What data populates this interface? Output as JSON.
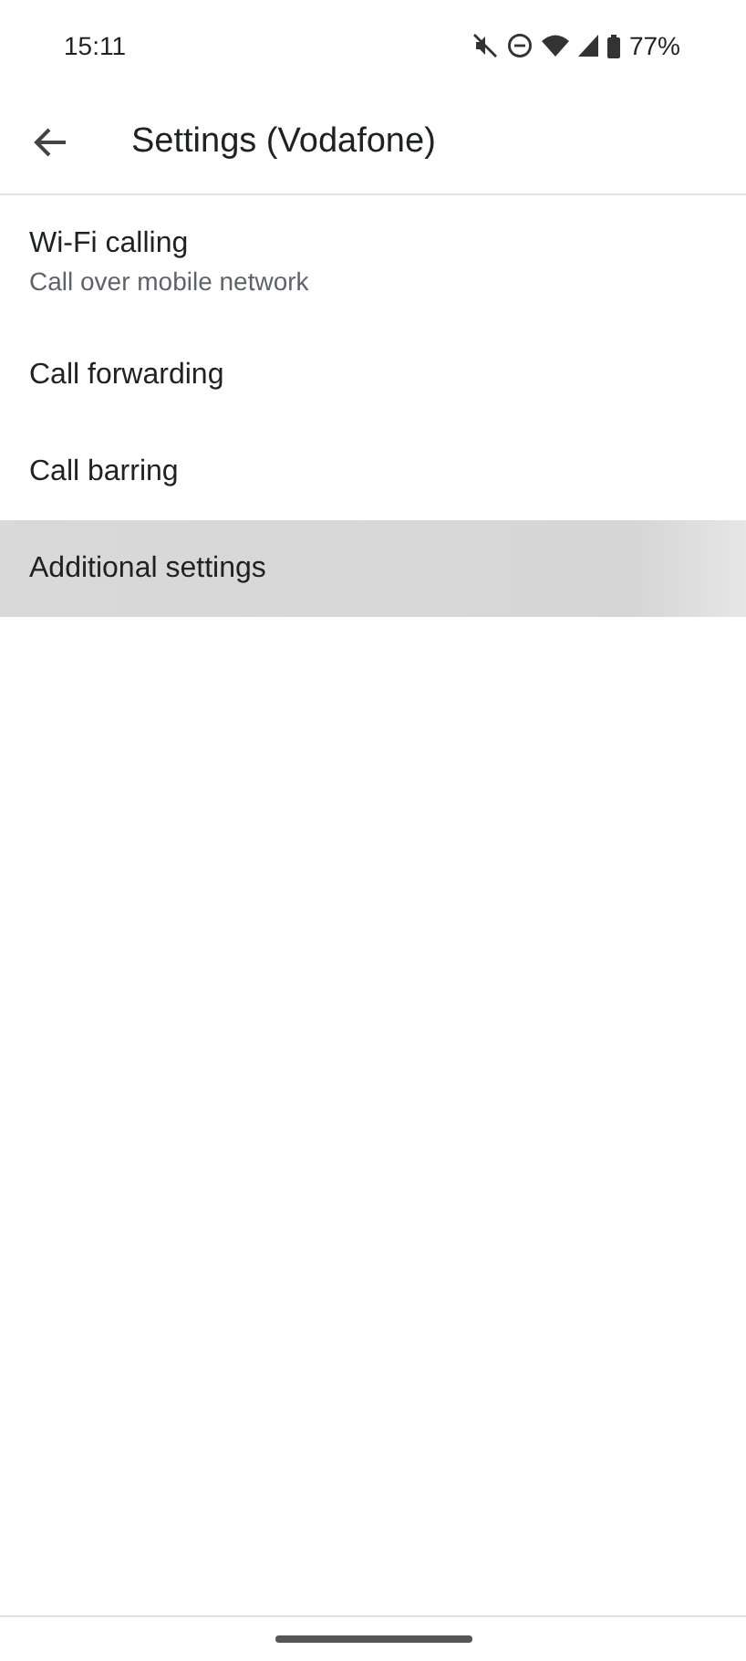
{
  "status_bar": {
    "time": "15:11",
    "battery": "77%"
  },
  "toolbar": {
    "title": "Settings (Vodafone)"
  },
  "items": [
    {
      "title": "Wi-Fi calling",
      "summary": "Call over mobile network",
      "selected": false
    },
    {
      "title": "Call forwarding",
      "selected": false
    },
    {
      "title": "Call barring",
      "selected": false
    },
    {
      "title": "Additional settings",
      "selected": true
    }
  ]
}
